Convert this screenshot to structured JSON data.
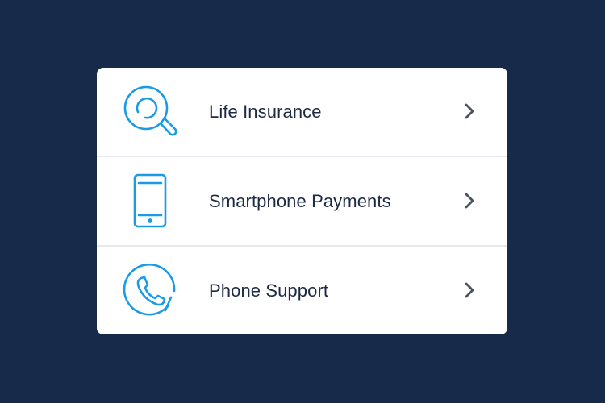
{
  "colors": {
    "background": "#172a4a",
    "card": "#ffffff",
    "icon_accent": "#1a9be6",
    "text": "#1d2a44",
    "chevron": "#4a5260",
    "divider": "#e6e9ee"
  },
  "menu": {
    "items": [
      {
        "label": "Life Insurance",
        "icon": "magnifier-icon",
        "action_icon": "chevron-right-icon"
      },
      {
        "label": "Smartphone Payments",
        "icon": "smartphone-icon",
        "action_icon": "chevron-right-icon"
      },
      {
        "label": "Phone Support",
        "icon": "phone-handset-icon",
        "action_icon": "chevron-right-icon"
      }
    ]
  }
}
